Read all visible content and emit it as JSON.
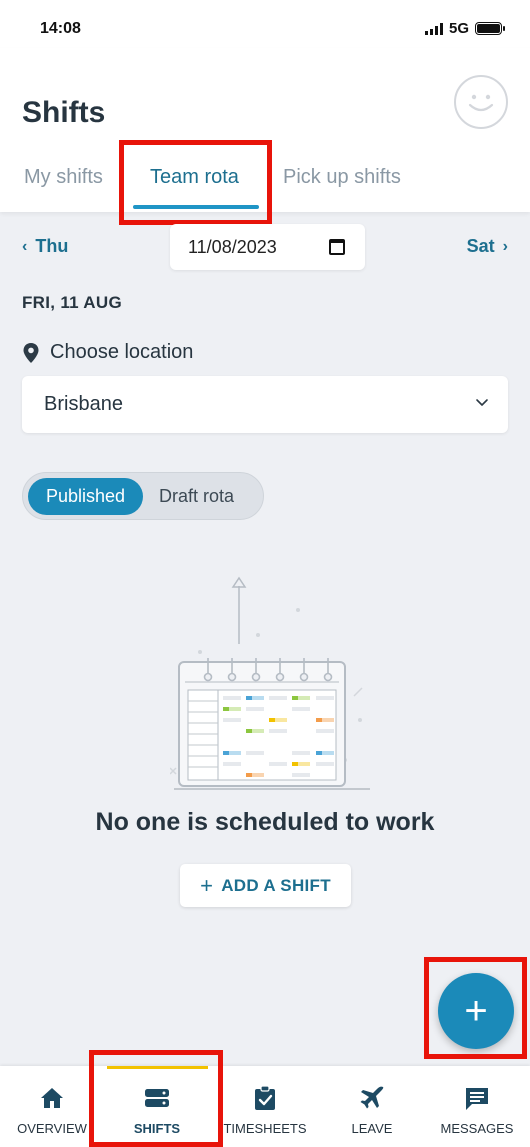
{
  "status_bar": {
    "time": "14:08",
    "network": "5G"
  },
  "page": {
    "title": "Shifts"
  },
  "tabs": [
    {
      "label": "My shifts"
    },
    {
      "label": "Team rota"
    },
    {
      "label": "Pick up shifts"
    }
  ],
  "date_nav": {
    "prev_label": "Thu",
    "next_label": "Sat",
    "date_value": "11/08/2023"
  },
  "day_label": "FRI, 11 AUG",
  "location": {
    "label": "Choose location",
    "value": "Brisbane"
  },
  "toggle": {
    "published_label": "Published",
    "draft_label": "Draft rota"
  },
  "empty_state": {
    "message": "No one is scheduled to work",
    "add_shift_label": "ADD A SHIFT"
  },
  "bottom_nav": [
    {
      "label": "OVERVIEW"
    },
    {
      "label": "SHIFTS"
    },
    {
      "label": "TIMESHEETS"
    },
    {
      "label": "LEAVE"
    },
    {
      "label": "MESSAGES"
    }
  ],
  "colors": {
    "accent": "#1b8ab9",
    "tab_active": "#1d6f8f",
    "highlight": "#e8140a",
    "nav_active_bar": "#f2c200"
  },
  "icons": [
    "avatar-smiley-icon",
    "chevron-left-icon",
    "chevron-right-icon",
    "calendar-icon",
    "location-pin-icon",
    "chevron-down-icon",
    "plus-icon",
    "home-icon",
    "shifts-icon",
    "timesheets-icon",
    "leave-icon",
    "messages-icon"
  ]
}
